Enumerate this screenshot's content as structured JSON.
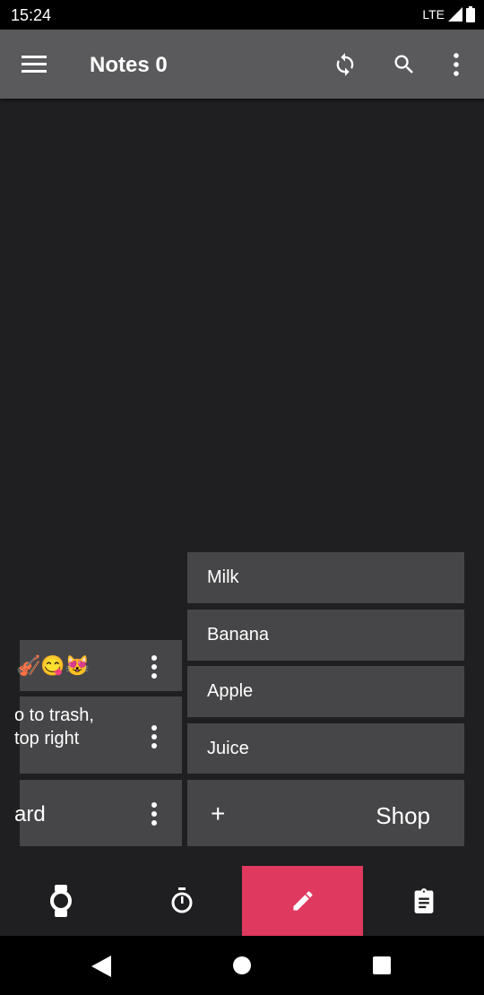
{
  "status": {
    "time": "15:24",
    "network": "LTE"
  },
  "toolbar": {
    "title": "Notes 0"
  },
  "notes_left": [
    {
      "text": "🎻😋😻"
    },
    {
      "text": "o to trash,\n top right"
    },
    {
      "text": "ard"
    }
  ],
  "shopping": {
    "items": [
      "Milk",
      "Banana",
      "Apple",
      "Juice"
    ],
    "add_symbol": "+",
    "title": "Shop"
  },
  "colors": {
    "accent": "#e0395f",
    "toolbar": "#5a5a5c",
    "card": "#464648",
    "background": "#1f1f21"
  },
  "bottom_nav": [
    {
      "icon": "watch-icon"
    },
    {
      "icon": "stopwatch-icon"
    },
    {
      "icon": "pencil-icon",
      "selected": true
    },
    {
      "icon": "clipboard-icon"
    }
  ]
}
